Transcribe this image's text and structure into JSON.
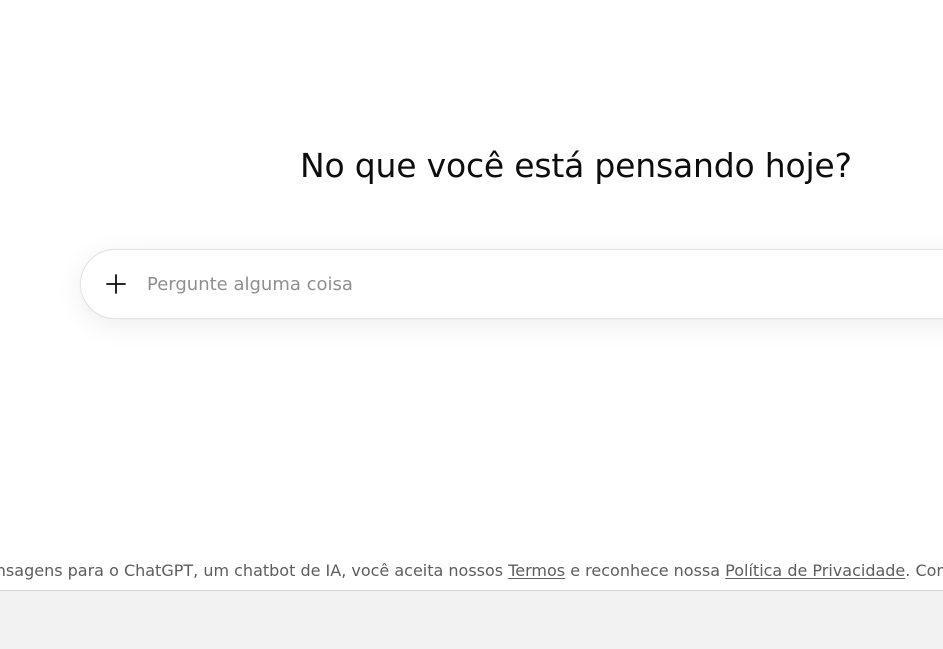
{
  "main": {
    "heading": "No que você está pensando hoje?"
  },
  "composer": {
    "placeholder": "Pergunte alguma coisa",
    "value": "",
    "plus_icon": "plus-icon"
  },
  "footer": {
    "terms_prefix": "ar mensagens para o ChatGPT, um chatbot de IA, você aceita nossos ",
    "terms_link": "Termos",
    "terms_middle": " e reconhece nossa ",
    "privacy_link": "Política de Privacidade",
    "terms_suffix": ". Cor"
  },
  "colors": {
    "background": "#ffffff",
    "text": "#0d0d0d",
    "placeholder": "#8f8f8f",
    "footer_text": "#5d5d5d",
    "bottom_strip": "#f2f2f2"
  }
}
